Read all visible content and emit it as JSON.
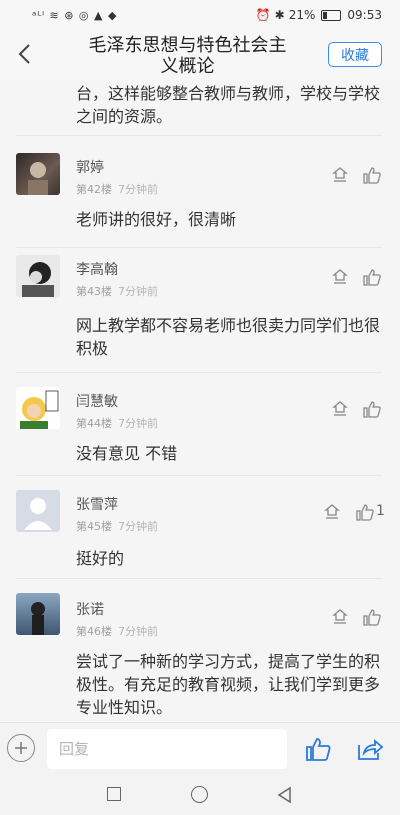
{
  "status_bar": {
    "signal": "ᵃᴸˡ ≋ ⊛ ◎ ▲ ◆",
    "right": "21%",
    "time": "09:53"
  },
  "header": {
    "title": "毛泽东思想与特色社会主义概论",
    "fav_label": "收藏"
  },
  "prev_comment_tail": "台，这样能够整合教师与教师，学校与学校之间的资源。",
  "comments": [
    {
      "name": "郭婷",
      "floor": "第42楼",
      "time": "7分钟前",
      "text": "老师讲的很好，很清晰",
      "likes": ""
    },
    {
      "name": "李高翰",
      "floor": "第43楼",
      "time": "7分钟前",
      "text": "网上教学都不容易老师也很卖力同学们也很积极",
      "likes": ""
    },
    {
      "name": "闫慧敏",
      "floor": "第44楼",
      "time": "7分钟前",
      "text": "没有意见  不错",
      "likes": ""
    },
    {
      "name": "张雪萍",
      "floor": "第45楼",
      "time": "7分钟前",
      "text": "挺好的",
      "likes": "1"
    },
    {
      "name": "张诺",
      "floor": "第46楼",
      "time": "7分钟前",
      "text": "尝试了一种新的学习方式，提高了学生的积极性。有充足的教育视频，让我们学到更多专业性知识。",
      "likes": ""
    }
  ],
  "input_bar": {
    "placeholder": "回复"
  },
  "colors": {
    "accent": "#2a7bd8",
    "background": "#f5f5f5"
  }
}
